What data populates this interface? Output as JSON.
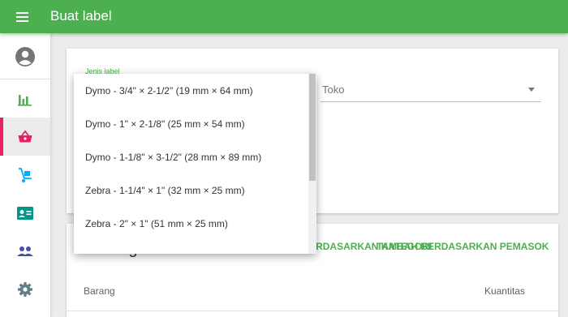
{
  "header": {
    "title": "Buat label"
  },
  "form": {
    "label_type_label": "Jenis label",
    "store_value": "Toko"
  },
  "dropdown": {
    "options": [
      "Dymo - 3/4\" × 2-1/2\" (19 mm × 64 mm)",
      "Dymo - 1\" × 2-1/8\" (25 mm × 54 mm)",
      "Dymo - 1-1/8\" × 3-1/2\" (28 mm × 89 mm)",
      "Zebra - 1-1/4\" × 1\" (32 mm × 25 mm)",
      "Zebra - 2\" × 1\" (51 mm × 25 mm)"
    ]
  },
  "items_card": {
    "title": "Barang",
    "add_by_category": "TAMBAH BERDASARKAN KATEGORI",
    "add_by_supplier": "TAMBAH BERDASARKAN PEMASOK",
    "col_item": "Barang",
    "col_qty": "Kuantitas"
  },
  "colors": {
    "primary": "#4caf50",
    "active_indicator": "#e91e63"
  }
}
